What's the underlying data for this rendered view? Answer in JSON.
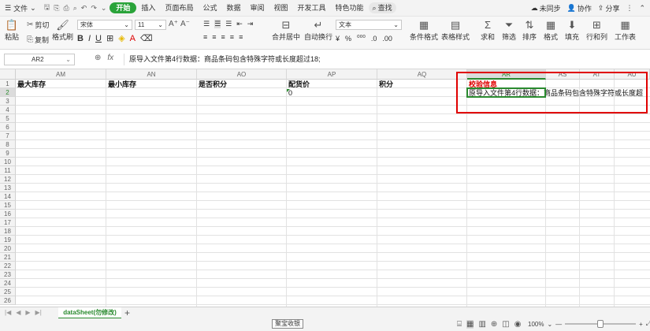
{
  "menu": {
    "file_label": "文件",
    "tabs": [
      "开始",
      "插入",
      "页面布局",
      "公式",
      "数据",
      "审阅",
      "视图",
      "开发工具",
      "特色功能"
    ],
    "active_tab": "开始",
    "search_label": "查找",
    "right": {
      "sync": "未同步",
      "collab": "协作",
      "share": "分享"
    }
  },
  "ribbon": {
    "paste": "粘贴",
    "cut": "剪切",
    "copy": "复制",
    "format_painter": "格式刷",
    "font_name": "宋体",
    "font_size": "11",
    "merge_center": "合并居中",
    "wrap_text": "自动换行",
    "number_format": "文本",
    "cond_format": "条件格式",
    "table_style": "表格样式",
    "sum": "求和",
    "filter": "筛选",
    "sort": "排序",
    "format": "格式",
    "fill": "填充",
    "rows_cols": "行和列",
    "worksheet": "工作表"
  },
  "formula_bar": {
    "name_box": "AR2",
    "formula": "原导入文件第4行数据：商品条码包含特殊字符或长度超过18;"
  },
  "grid": {
    "columns": [
      "AM",
      "AN",
      "AO",
      "AP",
      "AQ",
      "AR",
      "AS",
      "AT",
      "AU"
    ],
    "active_column": "AR",
    "rows": [
      "1",
      "2",
      "3",
      "4",
      "5",
      "6",
      "7",
      "8",
      "9",
      "10",
      "11",
      "12",
      "13",
      "14",
      "15",
      "16",
      "17",
      "18",
      "19",
      "20",
      "21",
      "22",
      "23",
      "24",
      "25",
      "26"
    ],
    "active_row": "2",
    "row1": {
      "AM": "最大库存",
      "AN": "最小库存",
      "AO": "是否积分",
      "AP": "配货价",
      "AQ": "积分",
      "AR": "校验信息"
    },
    "row2": {
      "AP": "0",
      "AR": "原导入文件第4行数据：商品条码包含特殊字符或长度超"
    }
  },
  "sheets": {
    "active": "dataSheet(勿修改)"
  },
  "status": {
    "tooltip": "聚宝收银",
    "zoom": "100%",
    "zoom_level": 1.0
  },
  "colors": {
    "accent": "#2aa33a",
    "highlight": "#e00000"
  }
}
